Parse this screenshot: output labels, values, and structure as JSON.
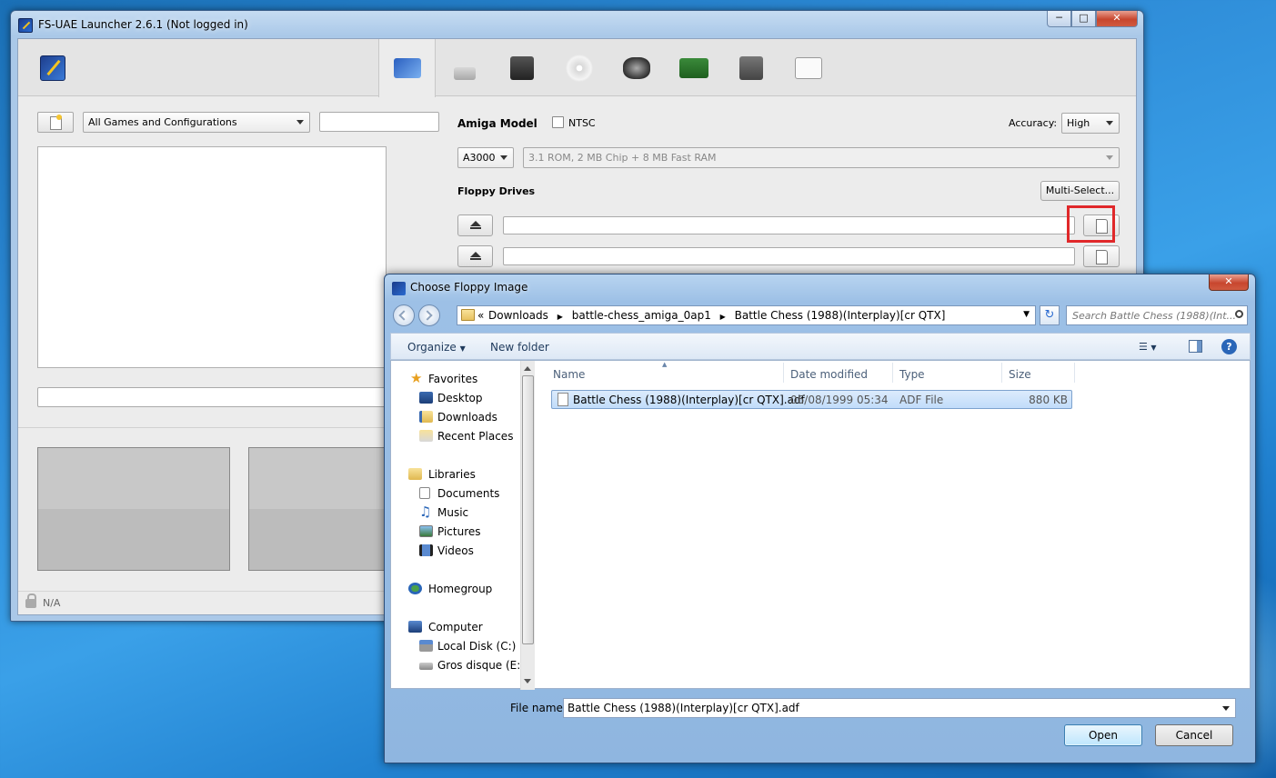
{
  "main_window": {
    "title": "FS-UAE Launcher 2.6.1 (Not logged in)",
    "left": {
      "filter_value": "All Games and Configurations",
      "search_value": "",
      "status": "N/A"
    },
    "right": {
      "amiga_model_label": "Amiga Model",
      "ntsc_label": "NTSC",
      "accuracy_label": "Accuracy:",
      "accuracy_value": "High",
      "model_value": "A3000",
      "rom_value": "3.1 ROM, 2 MB Chip + 8 MB Fast RAM",
      "floppy_label": "Floppy Drives",
      "multi_select_label": "Multi-Select..."
    },
    "tabs": [
      {
        "icon": "amiga-config-icon"
      },
      {
        "icon": "joystick-icon"
      },
      {
        "icon": "floppy-disk-icon"
      },
      {
        "icon": "cdrom-icon"
      },
      {
        "icon": "hard-drive-icon"
      },
      {
        "icon": "expansion-card-icon"
      },
      {
        "icon": "chip-rom-icon"
      },
      {
        "icon": "additional-config-icon"
      }
    ]
  },
  "dialog": {
    "title": "Choose Floppy Image",
    "breadcrumb": [
      "Downloads",
      "battle-chess_amiga_0ap1",
      "Battle Chess (1988)(Interplay)[cr QTX]"
    ],
    "search_placeholder": "Search Battle Chess (1988)(Int...",
    "toolbar": {
      "organize": "Organize",
      "new_folder": "New folder"
    },
    "nav": {
      "favorites": "Favorites",
      "desktop": "Desktop",
      "downloads": "Downloads",
      "recent": "Recent Places",
      "libraries": "Libraries",
      "documents": "Documents",
      "music": "Music",
      "pictures": "Pictures",
      "videos": "Videos",
      "homegroup": "Homegroup",
      "computer": "Computer",
      "local_disk": "Local Disk (C:)",
      "gros_disque": "Gros disque (E:)"
    },
    "columns": {
      "name": "Name",
      "date": "Date modified",
      "type": "Type",
      "size": "Size"
    },
    "files": [
      {
        "name": "Battle Chess (1988)(Interplay)[cr QTX].adf",
        "date": "06/08/1999 05:34",
        "type": "ADF File",
        "size": "880 KB"
      }
    ],
    "filename_label": "File name:",
    "filename_value": "Battle Chess (1988)(Interplay)[cr QTX].adf",
    "open_label": "Open",
    "cancel_label": "Cancel"
  },
  "colors": {
    "highlight_box": "#e0282a",
    "selection": "#c1dcfa"
  }
}
